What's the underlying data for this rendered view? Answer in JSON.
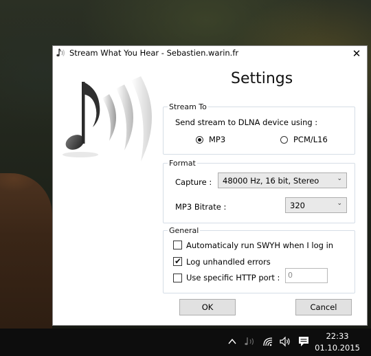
{
  "window": {
    "title": "Stream What You Hear - Sebastien.warin.fr",
    "close_glyph": "✕",
    "heading": "Settings"
  },
  "stream_to": {
    "legend": "Stream To",
    "label": "Send stream to DLNA device using :",
    "options": [
      {
        "label": "MP3",
        "selected": true
      },
      {
        "label": "PCM/L16",
        "selected": false
      }
    ]
  },
  "format": {
    "legend": "Format",
    "capture_label": "Capture :",
    "capture_value": "48000 Hz, 16 bit, Stereo",
    "bitrate_label": "MP3 Bitrate :",
    "bitrate_value": "320"
  },
  "general": {
    "legend": "General",
    "auto_run": {
      "label": "Automaticaly run SWYH when I log in",
      "checked": false
    },
    "log_errors": {
      "label": "Log unhandled errors",
      "checked": true
    },
    "http_port": {
      "label": "Use specific HTTP port :",
      "checked": false,
      "value": "0"
    }
  },
  "buttons": {
    "ok": "OK",
    "cancel": "Cancel"
  },
  "taskbar": {
    "time": "22:33",
    "date": "01.10.2015",
    "icons": [
      "chevron-up-icon",
      "swyh-tray-icon",
      "network-icon",
      "volume-icon",
      "notification-icon"
    ]
  },
  "colors": {
    "window_bg": "#ffffff",
    "groupbox_border": "#d5dde6",
    "button_bg": "#e1e1e1",
    "taskbar_bg": "#0d0d0d"
  }
}
